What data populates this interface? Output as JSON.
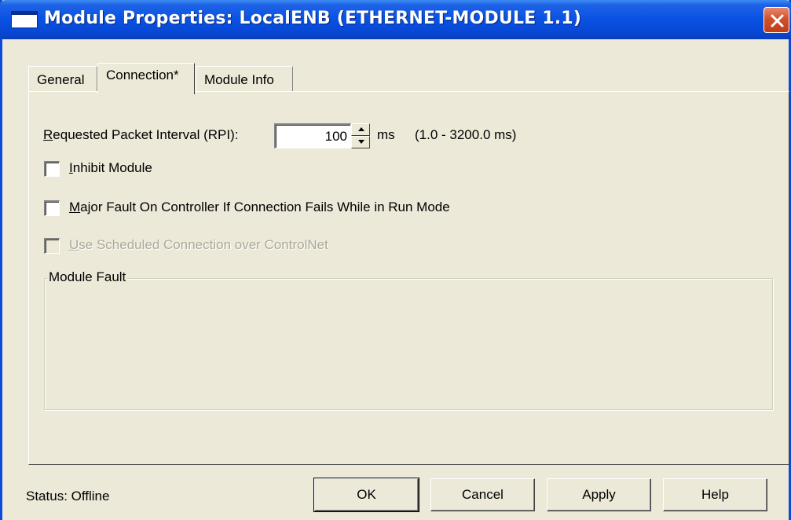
{
  "window": {
    "title": "Module Properties: LocalENB (ETHERNET-MODULE 1.1)"
  },
  "tabs": [
    {
      "label": "General",
      "active": false
    },
    {
      "label": "Connection*",
      "active": true
    },
    {
      "label": "Module Info",
      "active": false
    }
  ],
  "connection": {
    "rpi_label_first": "R",
    "rpi_label_rest": "equested Packet Interval (RPI):",
    "rpi_value": "100",
    "rpi_unit": "ms",
    "rpi_range": "(1.0 - 3200.0 ms)",
    "inhibit": {
      "u": "I",
      "rest": "nhibit Module",
      "checked": false
    },
    "major_fault": {
      "u": "M",
      "rest": "ajor Fault On Controller If Connection Fails While in Run Mode",
      "checked": false
    },
    "scheduled": {
      "u": "U",
      "rest": "se Scheduled Connection over ControlNet",
      "checked": false,
      "disabled": true
    },
    "module_fault_title": "Module Fault"
  },
  "status": {
    "text": "Status:  Offline"
  },
  "buttons": {
    "ok": "OK",
    "cancel": "Cancel",
    "apply": "Apply",
    "help": "Help"
  },
  "colors": {
    "titlebar": "#0a53e3",
    "dialog_bg": "#ece9d8",
    "close_button": "#d2502d",
    "disabled_text": "#aca899"
  }
}
